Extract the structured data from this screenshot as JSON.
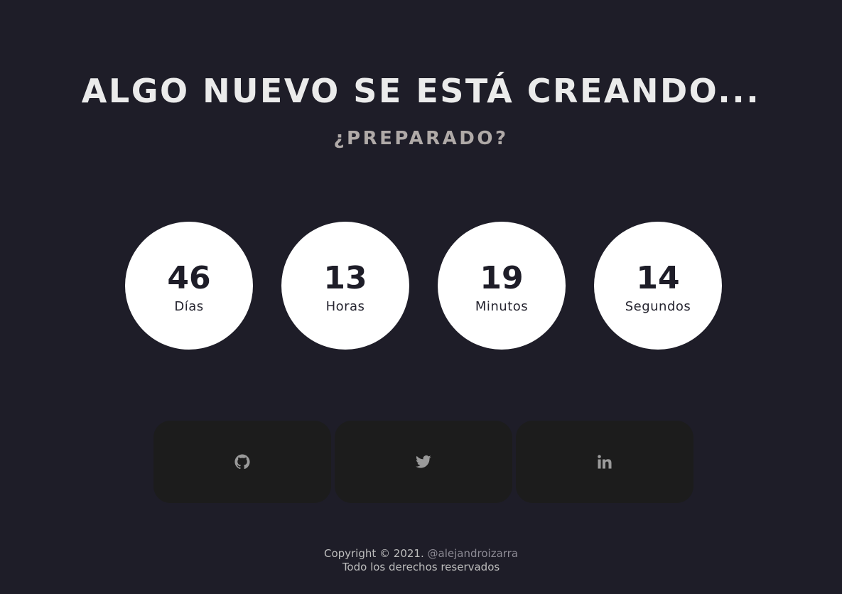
{
  "header": {
    "title": "ALGO NUEVO SE ESTÁ CREANDO...",
    "subtitle": "¿PREPARADO?"
  },
  "countdown": [
    {
      "value": "46",
      "label": "Días"
    },
    {
      "value": "13",
      "label": "Horas"
    },
    {
      "value": "19",
      "label": "Minutos"
    },
    {
      "value": "14",
      "label": "Segundos"
    }
  ],
  "socials": [
    {
      "icon": "github-icon"
    },
    {
      "icon": "twitter-icon"
    },
    {
      "icon": "linkedin-icon"
    }
  ],
  "footer": {
    "copyright": "Copyright © 2021.",
    "handle": "@alejandroizarra",
    "rights": "Todo los derechos reservados"
  },
  "colors": {
    "background": "#1e1d28",
    "circle": "#ffffff",
    "social_bg": "#1c1c1c",
    "icon": "#9a9a9a"
  }
}
